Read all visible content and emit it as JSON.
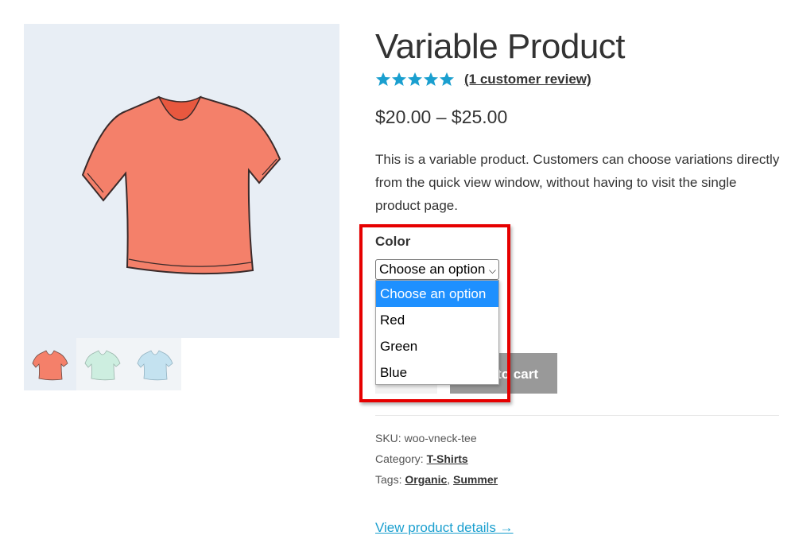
{
  "product": {
    "title": "Variable Product",
    "rating_stars": 5,
    "review_link": "(1 customer review)",
    "price": "$20.00 – $25.00",
    "description": "This is a variable product. Customers can choose variations directly from the quick view window, without having to visit the single product page."
  },
  "variation": {
    "label": "Color",
    "selected": "Choose an option",
    "options": [
      "Choose an option",
      "Red",
      "Green",
      "Blue"
    ]
  },
  "cart": {
    "button_label": "Add to cart"
  },
  "meta": {
    "sku_label": "SKU:",
    "sku": "woo-vneck-tee",
    "category_label": "Category:",
    "category": "T-Shirts",
    "tags_label": "Tags:",
    "tags": [
      "Organic",
      "Summer"
    ],
    "tags_separator": ","
  },
  "view_details": "View product details →",
  "colors": {
    "star": "#1a9fcf",
    "highlight": "#e60000",
    "dropdown_selected": "#1e90ff",
    "shirt_red": "#f4806a",
    "shirt_green": "#cdeee0",
    "shirt_blue": "#c4e2f0"
  },
  "icons": {
    "select_chevron": "chevron-down-icon",
    "star": "star-icon"
  }
}
